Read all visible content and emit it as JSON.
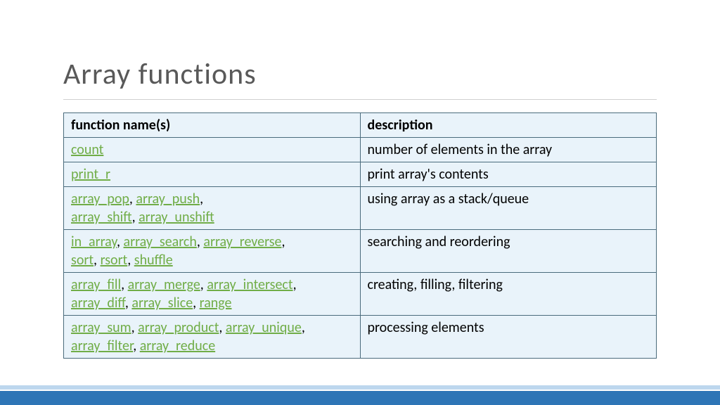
{
  "title": "Array functions",
  "headers": {
    "col1": "function name(s)",
    "col2": "description"
  },
  "rows": [
    {
      "funcs": [
        "count"
      ],
      "desc": "number of elements in the array"
    },
    {
      "funcs": [
        "print_r"
      ],
      "desc": "print array's contents"
    },
    {
      "funcs": [
        "array_pop",
        "array_push",
        "array_shift",
        "array_unshift"
      ],
      "break_after": 2,
      "desc": "using array as a stack/queue"
    },
    {
      "funcs": [
        "in_array",
        "array_search",
        "array_reverse",
        "sort",
        "rsort",
        "shuffle"
      ],
      "break_after": 3,
      "desc": "searching and reordering"
    },
    {
      "funcs": [
        "array_fill",
        "array_merge",
        "array_intersect",
        "array_diff",
        "array_slice",
        "range"
      ],
      "break_after": 3,
      "desc": "creating, filling, filtering"
    },
    {
      "funcs": [
        "array_sum",
        "array_product",
        "array_unique",
        "array_filter",
        "array_reduce"
      ],
      "break_after": 3,
      "desc": "processing elements"
    }
  ]
}
